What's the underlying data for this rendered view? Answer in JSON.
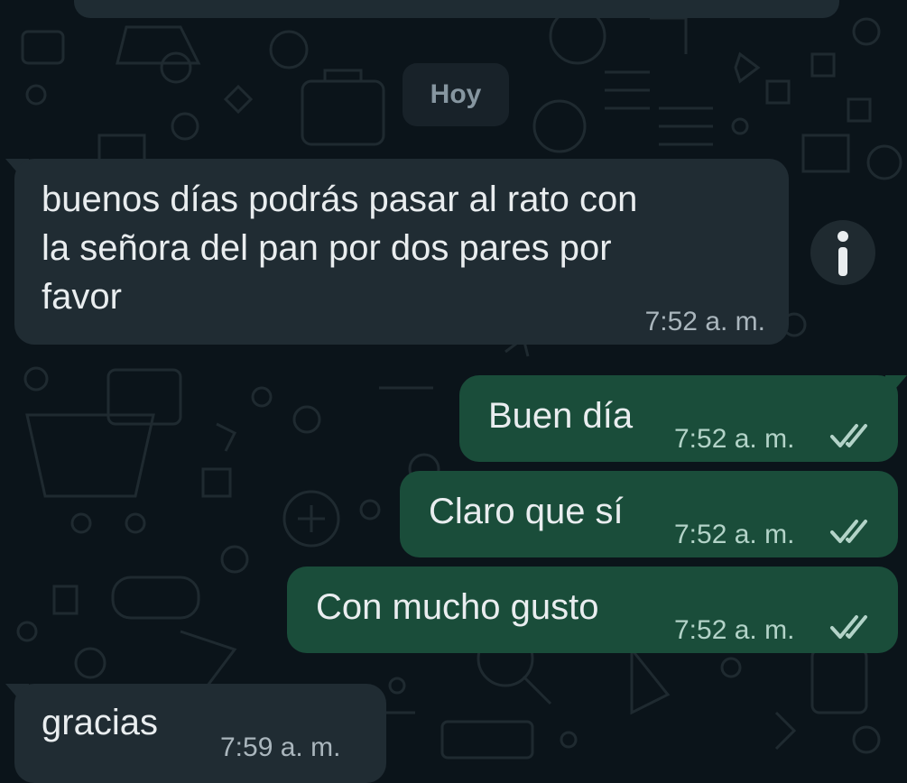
{
  "date_separator": "Hoy",
  "messages": [
    {
      "direction": "incoming",
      "lines": [
        "buenos días podrás pasar al rato con",
        "la señora del pan por dos pares por",
        "favor"
      ],
      "time": "7:52 a. m."
    },
    {
      "direction": "outgoing",
      "text": "Buen día",
      "time": "7:52 a. m.",
      "status": "read-ticks-icon"
    },
    {
      "direction": "outgoing",
      "text": "Claro que sí",
      "time": "7:52 a. m.",
      "status": "read-ticks-icon"
    },
    {
      "direction": "outgoing",
      "text": "Con mucho gusto",
      "time": "7:52 a. m.",
      "status": "read-ticks-icon"
    },
    {
      "direction": "incoming",
      "text": "gracias",
      "time": "7:59 a. m."
    }
  ],
  "icons": {
    "info": "info-icon",
    "ticks": "double-check-icon"
  },
  "colors": {
    "background": "#0b141a",
    "incoming_bubble": "#202c33",
    "outgoing_bubble": "#1a4d3a",
    "date_chip": "#182229",
    "text": "#e9edef",
    "meta_text": "#aab6bd"
  }
}
